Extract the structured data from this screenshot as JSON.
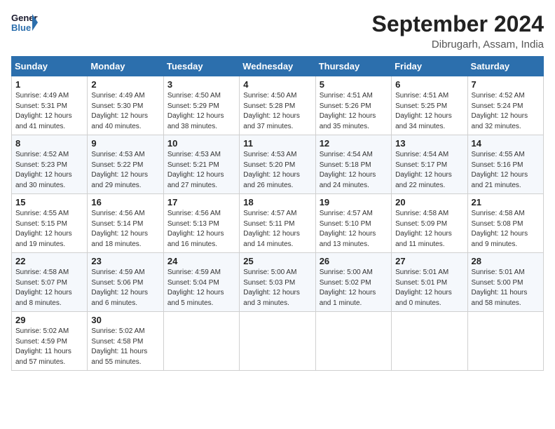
{
  "header": {
    "logo_line1": "General",
    "logo_line2": "Blue",
    "month": "September 2024",
    "location": "Dibrugarh, Assam, India"
  },
  "weekdays": [
    "Sunday",
    "Monday",
    "Tuesday",
    "Wednesday",
    "Thursday",
    "Friday",
    "Saturday"
  ],
  "weeks": [
    [
      {
        "day": "1",
        "rise": "4:49 AM",
        "set": "5:31 PM",
        "daylight": "12 hours and 41 minutes."
      },
      {
        "day": "2",
        "rise": "4:49 AM",
        "set": "5:30 PM",
        "daylight": "12 hours and 40 minutes."
      },
      {
        "day": "3",
        "rise": "4:50 AM",
        "set": "5:29 PM",
        "daylight": "12 hours and 38 minutes."
      },
      {
        "day": "4",
        "rise": "4:50 AM",
        "set": "5:28 PM",
        "daylight": "12 hours and 37 minutes."
      },
      {
        "day": "5",
        "rise": "4:51 AM",
        "set": "5:26 PM",
        "daylight": "12 hours and 35 minutes."
      },
      {
        "day": "6",
        "rise": "4:51 AM",
        "set": "5:25 PM",
        "daylight": "12 hours and 34 minutes."
      },
      {
        "day": "7",
        "rise": "4:52 AM",
        "set": "5:24 PM",
        "daylight": "12 hours and 32 minutes."
      }
    ],
    [
      {
        "day": "8",
        "rise": "4:52 AM",
        "set": "5:23 PM",
        "daylight": "12 hours and 30 minutes."
      },
      {
        "day": "9",
        "rise": "4:53 AM",
        "set": "5:22 PM",
        "daylight": "12 hours and 29 minutes."
      },
      {
        "day": "10",
        "rise": "4:53 AM",
        "set": "5:21 PM",
        "daylight": "12 hours and 27 minutes."
      },
      {
        "day": "11",
        "rise": "4:53 AM",
        "set": "5:20 PM",
        "daylight": "12 hours and 26 minutes."
      },
      {
        "day": "12",
        "rise": "4:54 AM",
        "set": "5:18 PM",
        "daylight": "12 hours and 24 minutes."
      },
      {
        "day": "13",
        "rise": "4:54 AM",
        "set": "5:17 PM",
        "daylight": "12 hours and 22 minutes."
      },
      {
        "day": "14",
        "rise": "4:55 AM",
        "set": "5:16 PM",
        "daylight": "12 hours and 21 minutes."
      }
    ],
    [
      {
        "day": "15",
        "rise": "4:55 AM",
        "set": "5:15 PM",
        "daylight": "12 hours and 19 minutes."
      },
      {
        "day": "16",
        "rise": "4:56 AM",
        "set": "5:14 PM",
        "daylight": "12 hours and 18 minutes."
      },
      {
        "day": "17",
        "rise": "4:56 AM",
        "set": "5:13 PM",
        "daylight": "12 hours and 16 minutes."
      },
      {
        "day": "18",
        "rise": "4:57 AM",
        "set": "5:11 PM",
        "daylight": "12 hours and 14 minutes."
      },
      {
        "day": "19",
        "rise": "4:57 AM",
        "set": "5:10 PM",
        "daylight": "12 hours and 13 minutes."
      },
      {
        "day": "20",
        "rise": "4:58 AM",
        "set": "5:09 PM",
        "daylight": "12 hours and 11 minutes."
      },
      {
        "day": "21",
        "rise": "4:58 AM",
        "set": "5:08 PM",
        "daylight": "12 hours and 9 minutes."
      }
    ],
    [
      {
        "day": "22",
        "rise": "4:58 AM",
        "set": "5:07 PM",
        "daylight": "12 hours and 8 minutes."
      },
      {
        "day": "23",
        "rise": "4:59 AM",
        "set": "5:06 PM",
        "daylight": "12 hours and 6 minutes."
      },
      {
        "day": "24",
        "rise": "4:59 AM",
        "set": "5:04 PM",
        "daylight": "12 hours and 5 minutes."
      },
      {
        "day": "25",
        "rise": "5:00 AM",
        "set": "5:03 PM",
        "daylight": "12 hours and 3 minutes."
      },
      {
        "day": "26",
        "rise": "5:00 AM",
        "set": "5:02 PM",
        "daylight": "12 hours and 1 minute."
      },
      {
        "day": "27",
        "rise": "5:01 AM",
        "set": "5:01 PM",
        "daylight": "12 hours and 0 minutes."
      },
      {
        "day": "28",
        "rise": "5:01 AM",
        "set": "5:00 PM",
        "daylight": "11 hours and 58 minutes."
      }
    ],
    [
      {
        "day": "29",
        "rise": "5:02 AM",
        "set": "4:59 PM",
        "daylight": "11 hours and 57 minutes."
      },
      {
        "day": "30",
        "rise": "5:02 AM",
        "set": "4:58 PM",
        "daylight": "11 hours and 55 minutes."
      },
      null,
      null,
      null,
      null,
      null
    ]
  ],
  "labels": {
    "sunrise": "Sunrise:",
    "sunset": "Sunset:",
    "daylight": "Daylight:"
  }
}
